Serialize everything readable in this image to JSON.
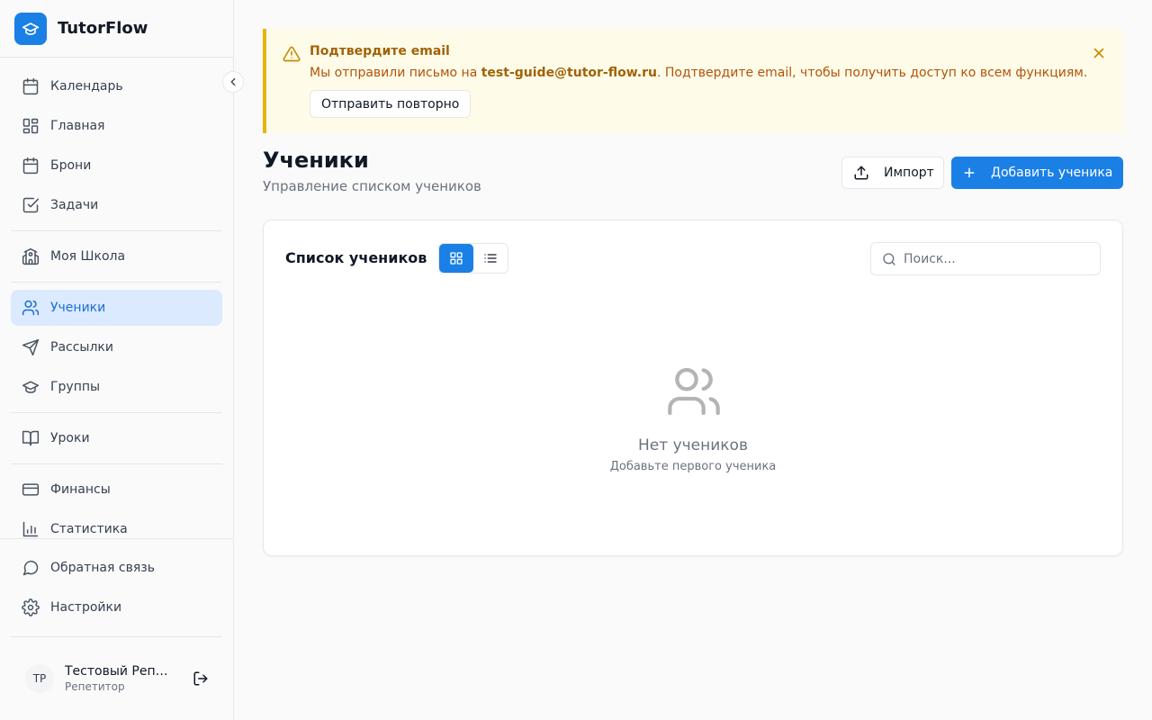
{
  "app": {
    "name": "TutorFlow"
  },
  "sidebar": {
    "items": [
      {
        "label": "Календарь"
      },
      {
        "label": "Главная"
      },
      {
        "label": "Брони"
      },
      {
        "label": "Задачи"
      },
      {
        "label": "Моя Школа"
      },
      {
        "label": "Ученики",
        "active": true
      },
      {
        "label": "Рассылки"
      },
      {
        "label": "Группы"
      },
      {
        "label": "Уроки"
      },
      {
        "label": "Финансы"
      },
      {
        "label": "Статистика"
      }
    ],
    "footer_items": [
      {
        "label": "Обратная связь"
      },
      {
        "label": "Настройки"
      }
    ],
    "user": {
      "initials": "ТР",
      "name": "Тестовый Репетитор",
      "role": "Репетитор"
    }
  },
  "alert": {
    "title": "Подтвердите email",
    "text_prefix": "Мы отправили письмо на ",
    "email": "test-guide@tutor-flow.ru",
    "text_suffix": ". Подтвердите email, чтобы получить доступ ко всем функциям.",
    "resend_label": "Отправить повторно"
  },
  "page": {
    "title": "Ученики",
    "subtitle": "Управление списком учеников",
    "import_label": "Импорт",
    "add_label": "Добавить ученика"
  },
  "card": {
    "title": "Список учеников",
    "search_placeholder": "Поиск...",
    "empty_title": "Нет учеников",
    "empty_subtitle": "Добавьте первого ученика"
  },
  "colors": {
    "accent": "#1a80e5",
    "alert_bg": "#fefce8",
    "alert_border": "#eab308"
  }
}
